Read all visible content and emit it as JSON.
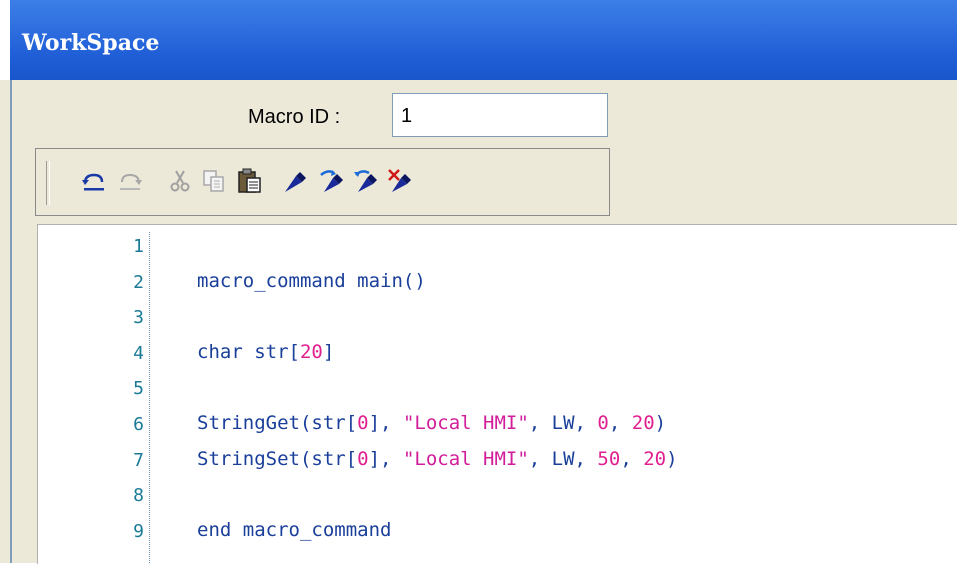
{
  "window": {
    "title": "WorkSpace"
  },
  "macro": {
    "label": "Macro ID :",
    "value": "1"
  },
  "toolbar": {
    "icons": [
      "undo-icon",
      "redo-icon",
      "cut-icon",
      "copy-icon",
      "paste-icon",
      "brush-icon",
      "brush-forward-icon",
      "brush-back-icon",
      "brush-delete-icon"
    ]
  },
  "editor": {
    "lines": [
      {
        "num": "1",
        "parts": []
      },
      {
        "num": "2",
        "parts": [
          {
            "t": "macro_command main()",
            "c": "kw"
          }
        ]
      },
      {
        "num": "3",
        "parts": []
      },
      {
        "num": "4",
        "parts": [
          {
            "t": "char str[",
            "c": "kw"
          },
          {
            "t": "20",
            "c": "num"
          },
          {
            "t": "]",
            "c": "kw"
          }
        ]
      },
      {
        "num": "5",
        "parts": []
      },
      {
        "num": "6",
        "parts": [
          {
            "t": "StringGet(str[",
            "c": "kw"
          },
          {
            "t": "0",
            "c": "num"
          },
          {
            "t": "], ",
            "c": "kw"
          },
          {
            "t": "\"Local HMI\"",
            "c": "str"
          },
          {
            "t": ", LW, ",
            "c": "kw"
          },
          {
            "t": "0",
            "c": "num"
          },
          {
            "t": ", ",
            "c": "kw"
          },
          {
            "t": "20",
            "c": "num"
          },
          {
            "t": ")",
            "c": "kw"
          }
        ]
      },
      {
        "num": "7",
        "parts": [
          {
            "t": "StringSet(str[",
            "c": "kw"
          },
          {
            "t": "0",
            "c": "num"
          },
          {
            "t": "], ",
            "c": "kw"
          },
          {
            "t": "\"Local HMI\"",
            "c": "str"
          },
          {
            "t": ", LW, ",
            "c": "kw"
          },
          {
            "t": "50",
            "c": "num"
          },
          {
            "t": ", ",
            "c": "kw"
          },
          {
            "t": "20",
            "c": "num"
          },
          {
            "t": ")",
            "c": "kw"
          }
        ]
      },
      {
        "num": "8",
        "parts": []
      },
      {
        "num": "9",
        "parts": [
          {
            "t": "end macro_command",
            "c": "kw"
          }
        ]
      }
    ]
  },
  "colors": {
    "titlebar": "#1f5ed6",
    "code_text": "#1a3f9a",
    "code_number": "#e0208f",
    "code_string": "#d11d9a",
    "line_number": "#1a7a96"
  }
}
